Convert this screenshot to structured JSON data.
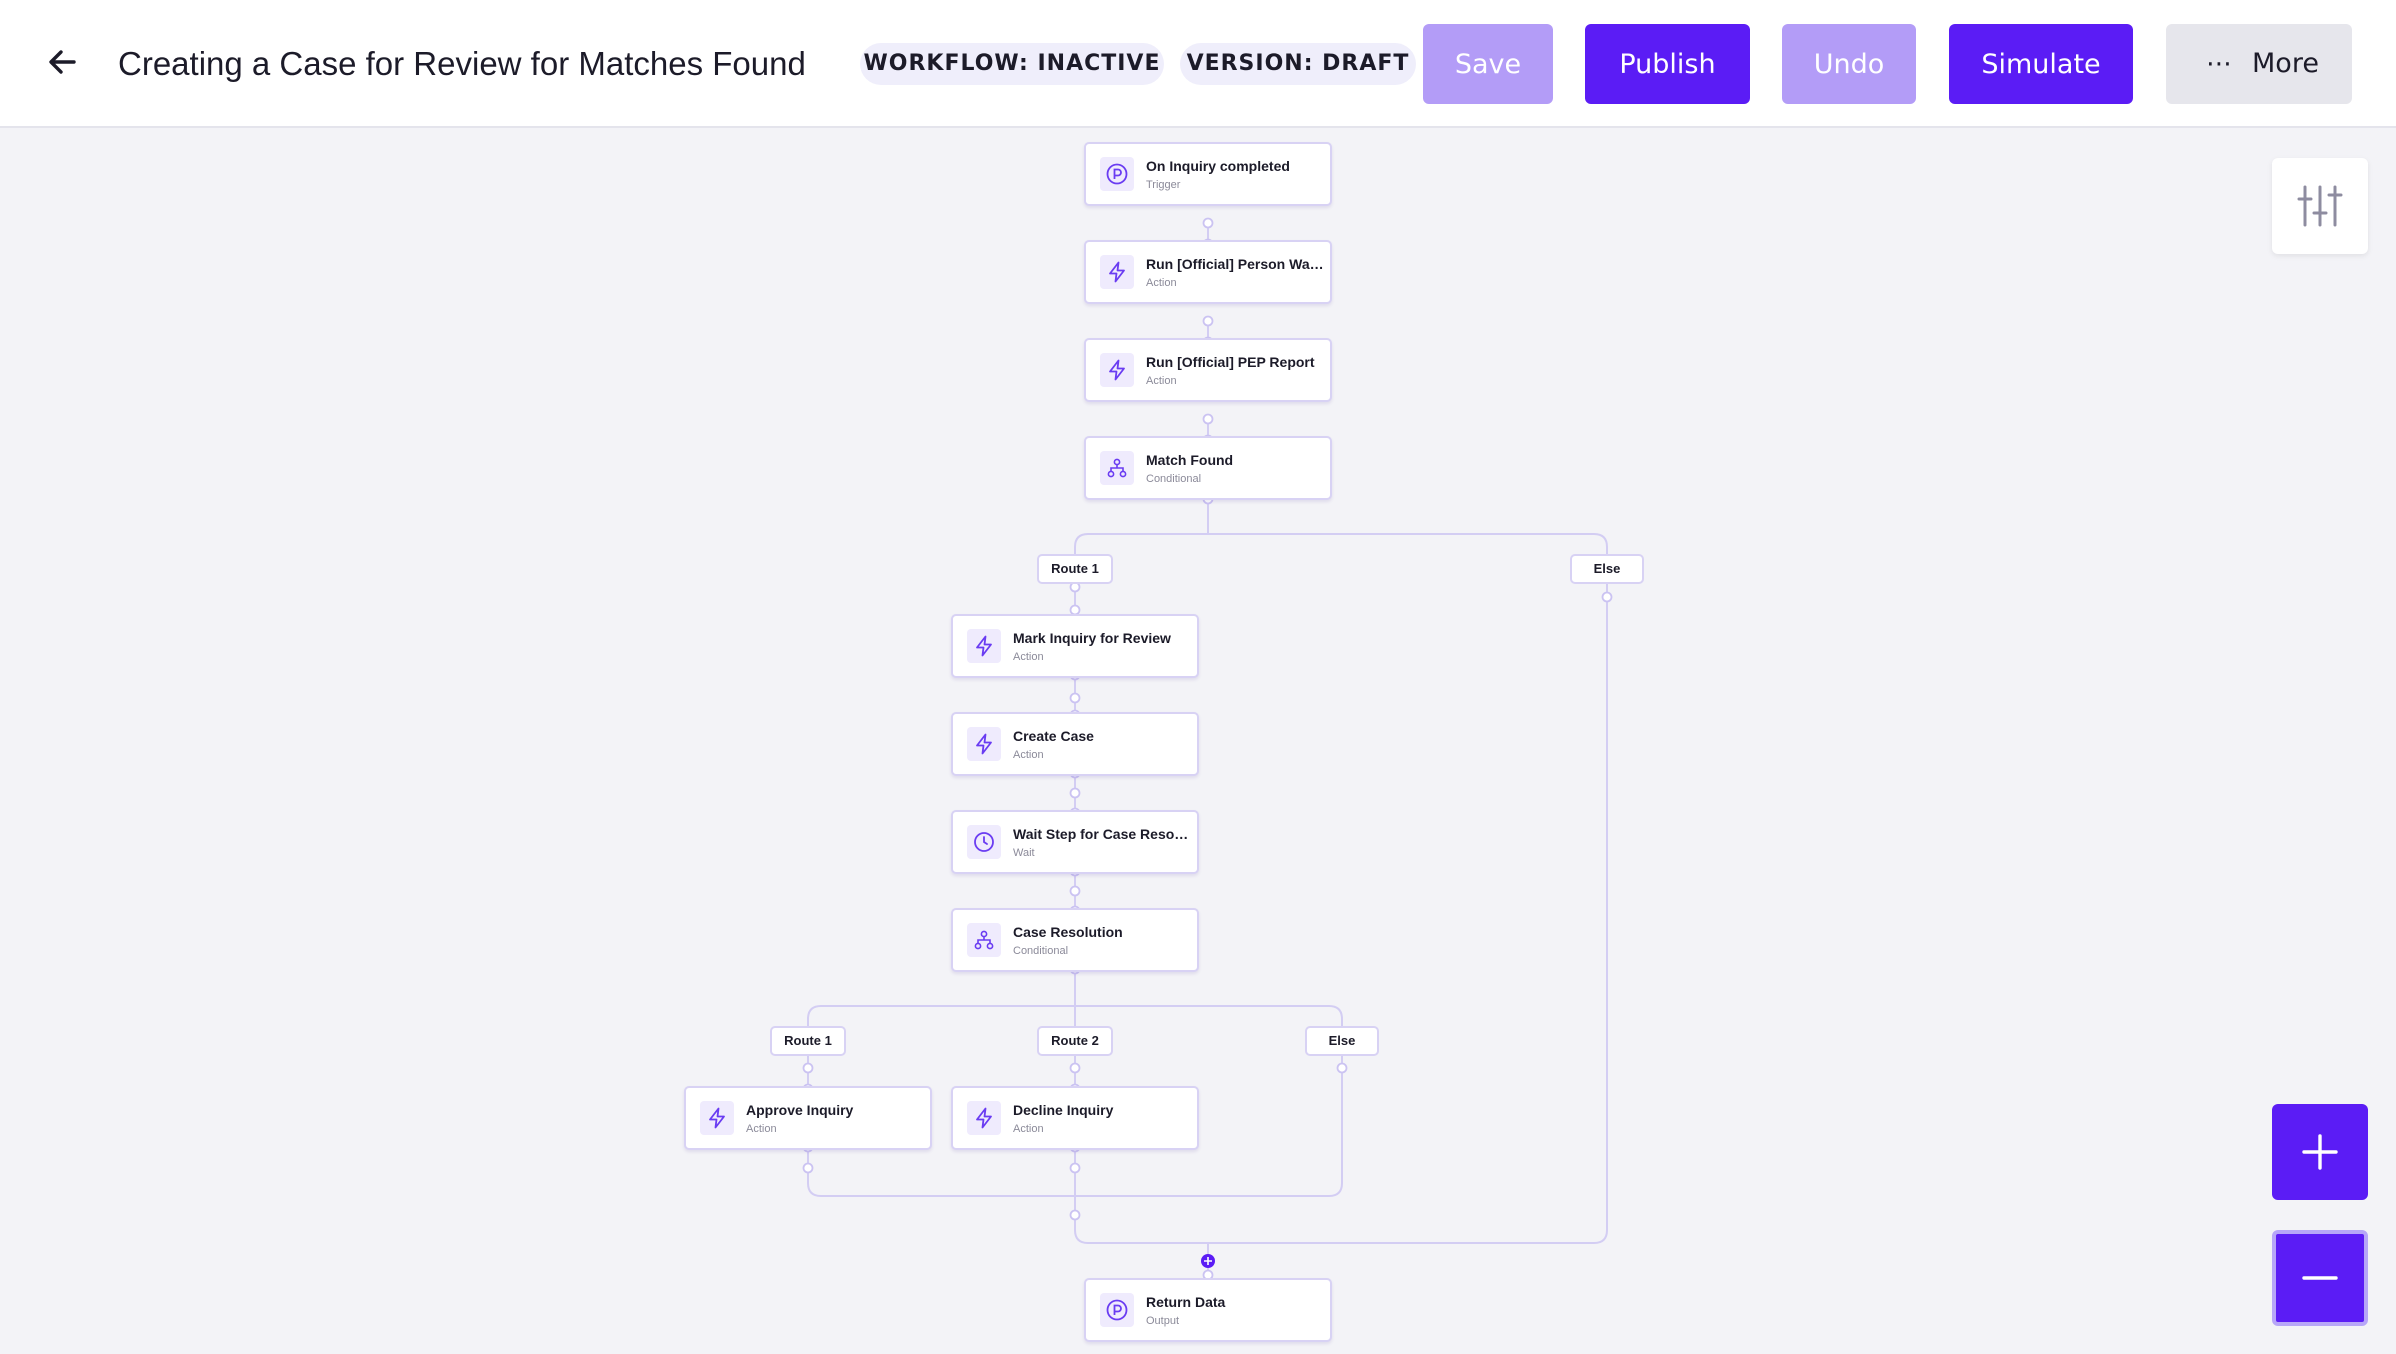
{
  "header": {
    "title": "Creating a Case for Review for Matches Found",
    "workflow_status": "WORKFLOW: INACTIVE",
    "version_status": "VERSION: DRAFT",
    "save_label": "Save",
    "publish_label": "Publish",
    "undo_label": "Undo",
    "simulate_label": "Simulate",
    "more_label": "More"
  },
  "colors": {
    "accent": "#5b1cf5",
    "accent_disabled": "#b39cf7",
    "edge": "#d3cdf3"
  },
  "nodes": {
    "trigger": {
      "title": "On Inquiry completed",
      "type": "Trigger",
      "icon": "persona-icon"
    },
    "person_watchlist": {
      "title": "Run [Official] Person Watchlist",
      "type": "Action",
      "icon": "lightning-icon"
    },
    "pep_report": {
      "title": "Run [Official] PEP Report",
      "type": "Action",
      "icon": "lightning-icon"
    },
    "match_found": {
      "title": "Match Found",
      "type": "Conditional",
      "icon": "branch-icon"
    },
    "mark_review": {
      "title": "Mark Inquiry for Review",
      "type": "Action",
      "icon": "lightning-icon"
    },
    "create_case": {
      "title": "Create Case",
      "type": "Action",
      "icon": "lightning-icon"
    },
    "wait_step": {
      "title": "Wait Step for Case Resolution",
      "type": "Wait",
      "icon": "clock-icon"
    },
    "case_resolution": {
      "title": "Case Resolution",
      "type": "Conditional",
      "icon": "branch-icon"
    },
    "approve": {
      "title": "Approve Inquiry",
      "type": "Action",
      "icon": "lightning-icon"
    },
    "decline": {
      "title": "Decline Inquiry",
      "type": "Action",
      "icon": "lightning-icon"
    },
    "return_data": {
      "title": "Return Data",
      "type": "Output",
      "icon": "persona-icon"
    }
  },
  "routes": {
    "match_route1": "Route 1",
    "match_else": "Else",
    "case_route1": "Route 1",
    "case_route2": "Route 2",
    "case_else": "Else"
  }
}
